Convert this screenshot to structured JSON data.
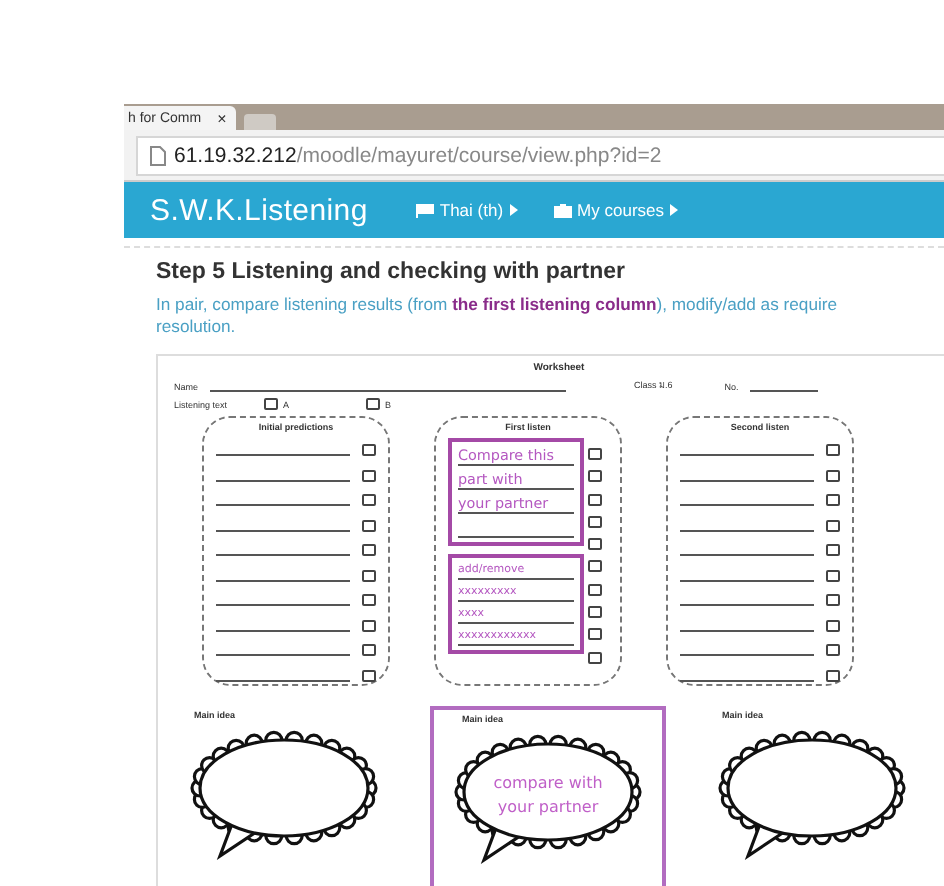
{
  "browser": {
    "tab_title": "h for Comm",
    "tab_close": "×",
    "address_host": "61.19.32.212",
    "address_path": "/moodle/mayuret/course/view.php?id=2"
  },
  "navbar": {
    "brand": "S.W.K.Listening",
    "menus": [
      {
        "label": "Thai (th)",
        "kind": "flag"
      },
      {
        "label": "My courses",
        "kind": "briefcase"
      }
    ]
  },
  "content": {
    "heading": "Step 5 Listening and checking with partner",
    "instruction": "In pair, compare listening results (from **the first listening column**), modify/add as require",
    "instruction_end": "resolution."
  },
  "worksheet": {
    "title": "Worksheet",
    "name_label": "Name",
    "class_label": "Class ม.6",
    "no_label": "No.",
    "listening_text_label": "Listening text",
    "options": [
      {
        "label": "A",
        "checked": false
      },
      {
        "label": "B",
        "checked": false
      }
    ],
    "columns": [
      {
        "title": "Initial predictions",
        "rows": [
          {
            "checked": false
          },
          {
            "checked": false
          },
          {
            "checked": false
          },
          {
            "checked": false
          },
          {
            "checked": false
          },
          {
            "checked": false
          },
          {
            "checked": false
          },
          {
            "checked": false
          },
          {
            "checked": false
          },
          {
            "checked": false
          }
        ]
      },
      {
        "title": "First listen",
        "rows": [
          {
            "checked": false
          },
          {
            "checked": false
          },
          {
            "checked": false
          },
          {
            "checked": false
          },
          {
            "checked": false
          },
          {
            "checked": false
          },
          {
            "checked": false
          },
          {
            "checked": false
          },
          {
            "checked": false
          },
          {
            "checked": false
          }
        ],
        "notes": [
          {
            "lines": [
              "Compare this",
              "part with",
              "your partner"
            ],
            "blank_line": true
          },
          {
            "lines": [
              "add/remove",
              "xxxxxxxxx",
              "xxxx",
              "xxxxxxxxxxxx"
            ],
            "blank_line": false
          }
        ]
      },
      {
        "title": "Second listen",
        "rows": [
          {
            "checked": false
          },
          {
            "checked": false
          },
          {
            "checked": false
          },
          {
            "checked": false
          },
          {
            "checked": false
          },
          {
            "checked": false
          },
          {
            "checked": false
          },
          {
            "checked": false
          },
          {
            "checked": false
          },
          {
            "checked": false
          }
        ]
      }
    ],
    "main_ideas": [
      {
        "label": "Main idea",
        "highlighted": false
      },
      {
        "label": "Main idea",
        "highlighted": true,
        "lines": [
          "compare with",
          "your partner"
        ]
      },
      {
        "label": "Main idea",
        "highlighted": false
      }
    ]
  }
}
